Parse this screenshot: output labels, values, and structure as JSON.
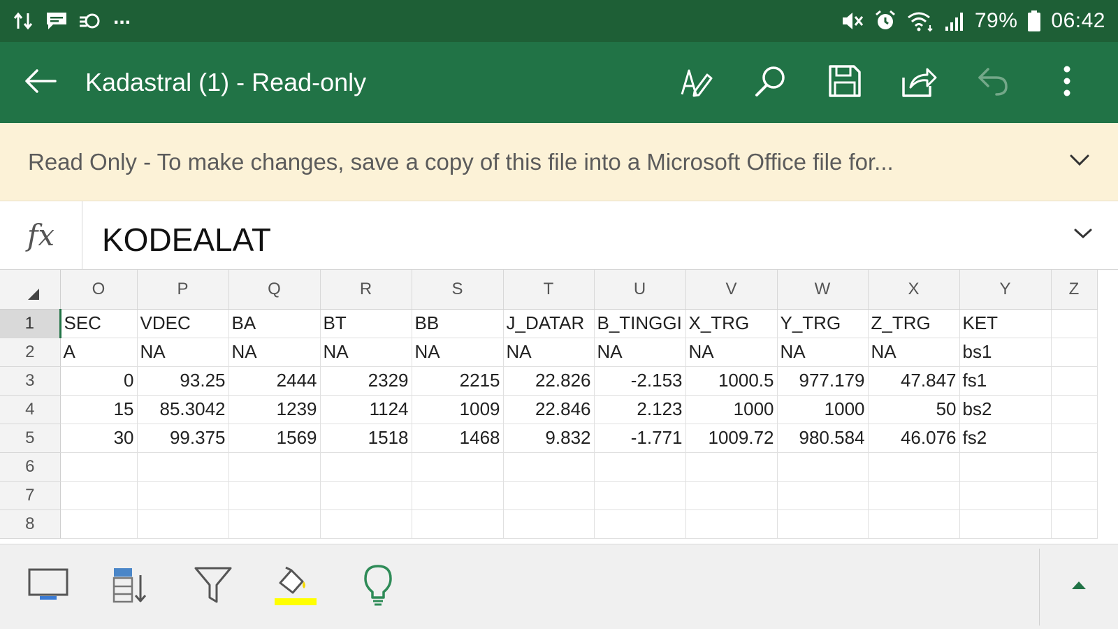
{
  "status": {
    "battery": "79%",
    "time": "06:42",
    "dots": "..."
  },
  "appbar": {
    "title": "Kadastral (1) - Read-only",
    "icons": [
      "back-arrow-icon",
      "draw-pen-icon",
      "search-icon",
      "save-icon",
      "share-icon",
      "undo-icon",
      "more-vert-icon"
    ]
  },
  "banner": {
    "text": "Read Only - To make changes, save a copy of this file into a Microsoft Office file for..."
  },
  "formula": {
    "label": "fx",
    "value": "KODEALAT"
  },
  "sheet": {
    "columns": [
      "O",
      "P",
      "Q",
      "R",
      "S",
      "T",
      "U",
      "V",
      "W",
      "X",
      "Y",
      "Z"
    ],
    "rows": [
      {
        "num": "1",
        "cells": [
          "SEC",
          "VDEC",
          "BA",
          "BT",
          "BB",
          "J_DATAR",
          "B_TINGGI",
          "X_TRG",
          "Y_TRG",
          "Z_TRG",
          "KET",
          ""
        ]
      },
      {
        "num": "2",
        "cells": [
          "A",
          "NA",
          "NA",
          "NA",
          "NA",
          "NA",
          "NA",
          "NA",
          "NA",
          "NA",
          "bs1",
          ""
        ]
      },
      {
        "num": "3",
        "cells": [
          "0",
          "93.25",
          "2444",
          "2329",
          "2215",
          "22.826",
          "-2.153",
          "1000.5",
          "977.179",
          "47.847",
          "fs1",
          ""
        ]
      },
      {
        "num": "4",
        "cells": [
          "15",
          "85.3042",
          "1239",
          "1124",
          "1009",
          "22.846",
          "2.123",
          "1000",
          "1000",
          "50",
          "bs2",
          ""
        ]
      },
      {
        "num": "5",
        "cells": [
          "30",
          "99.375",
          "1569",
          "1518",
          "1468",
          "9.832",
          "-1.771",
          "1009.72",
          "980.584",
          "46.076",
          "fs2",
          ""
        ]
      },
      {
        "num": "6",
        "cells": [
          "",
          "",
          "",
          "",
          "",
          "",
          "",
          "",
          "",
          "",
          "",
          ""
        ]
      },
      {
        "num": "7",
        "cells": [
          "",
          "",
          "",
          "",
          "",
          "",
          "",
          "",
          "",
          "",
          "",
          ""
        ]
      },
      {
        "num": "8",
        "cells": [
          "",
          "",
          "",
          "",
          "",
          "",
          "",
          "",
          "",
          "",
          "",
          ""
        ]
      }
    ],
    "selected_row": "1"
  },
  "toolbar": {
    "icons": [
      "screen-view-icon",
      "sort-icon",
      "filter-icon",
      "fill-color-icon",
      "tell-me-lightbulb-icon",
      "expand-up-icon"
    ],
    "fill_highlight_color": "#ffff00",
    "lightbulb_color": "#2e8b57"
  },
  "colors": {
    "status_bar": "#1e5f36",
    "app_bar": "#217346",
    "banner_bg": "#fcf2d7"
  }
}
